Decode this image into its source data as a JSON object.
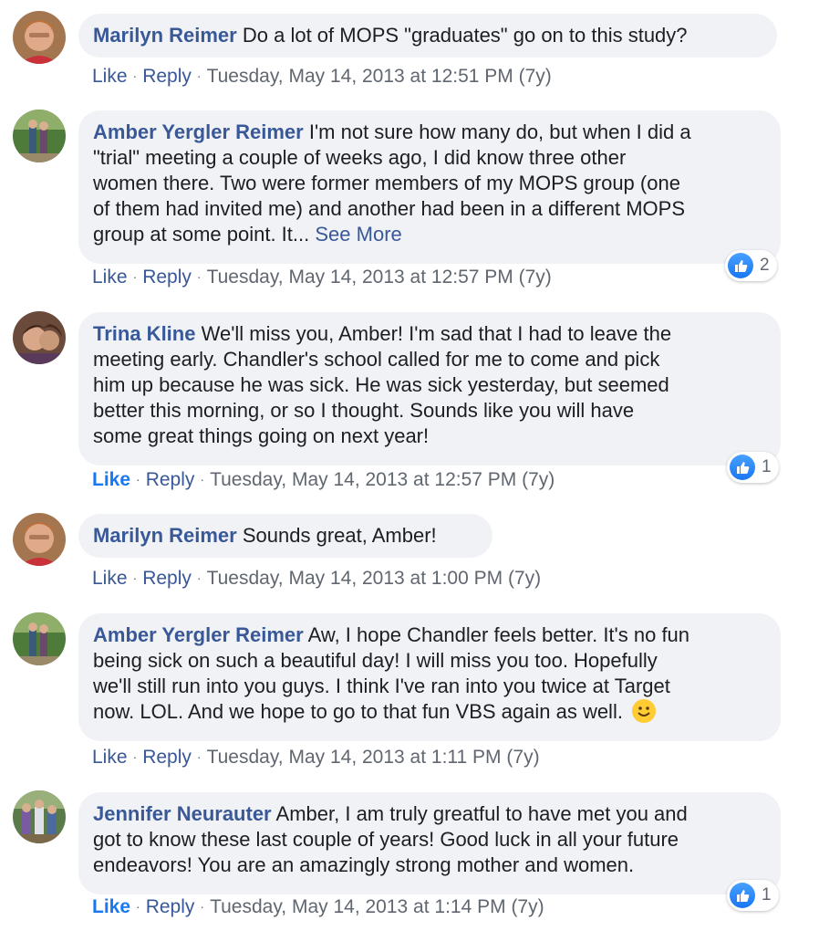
{
  "comments": [
    {
      "author": "Marilyn Reimer",
      "text": "Do a lot of MOPS \"graduates\" go on to this study?",
      "like": "Like",
      "reply": "Reply",
      "timestamp": "Tuesday, May 14, 2013 at 12:51 PM",
      "age": "(7y)",
      "avatar": "avatar-marilyn"
    },
    {
      "author": "Amber Yergler Reimer",
      "text_lines": [
        "I'm not sure how many do, but when I did a",
        "\"trial\" meeting a couple of weeks ago, I did know three other",
        "women there. Two were former members of my MOPS group (one",
        "of them had invited me) and another had been in a different MOPS",
        "group at some point. It..."
      ],
      "see_more": "See More",
      "like": "Like",
      "reply": "Reply",
      "timestamp": "Tuesday, May 14, 2013 at 12:57 PM",
      "age": "(7y)",
      "reaction_count": "2",
      "avatar": "avatar-amber"
    },
    {
      "author": "Trina Kline",
      "text_lines": [
        "We'll miss you, Amber! I'm sad that I had to leave the",
        "meeting early. Chandler's school called for me to come and pick",
        "him up because he was sick. He was sick yesterday, but seemed",
        "better this morning, or so I thought. Sounds like you will have",
        "some great things going on next year!"
      ],
      "like": "Like",
      "reply": "Reply",
      "timestamp": "Tuesday, May 14, 2013 at 12:57 PM",
      "age": "(7y)",
      "reaction_count": "1",
      "liked": true,
      "avatar": "avatar-trina"
    },
    {
      "author": "Marilyn Reimer",
      "text": "Sounds great, Amber!",
      "like": "Like",
      "reply": "Reply",
      "timestamp": "Tuesday, May 14, 2013 at 1:00 PM",
      "age": "(7y)",
      "avatar": "avatar-marilyn"
    },
    {
      "author": "Amber Yergler Reimer",
      "text_lines": [
        "Aw, I hope Chandler feels better. It's no fun",
        "being sick on such a beautiful day! I will miss you too. Hopefully",
        "we'll still run into you guys. I think I've ran into you twice at Target",
        "now. LOL. And we hope to go to that fun VBS again as well."
      ],
      "emoji": "smiley-emoji",
      "like": "Like",
      "reply": "Reply",
      "timestamp": "Tuesday, May 14, 2013 at 1:11 PM",
      "age": "(7y)",
      "avatar": "avatar-amber"
    },
    {
      "author": "Jennifer Neurauter",
      "text_lines": [
        "Amber, I am truly greatful to have met you and",
        "got to know these last couple of years! Good luck in all your future",
        "endeavors! You are an amazingly strong mother and women."
      ],
      "like": "Like",
      "reply": "Reply",
      "timestamp": "Tuesday, May 14, 2013 at 1:14 PM",
      "age": "(7y)",
      "reaction_count": "1",
      "liked": true,
      "avatar": "avatar-jennifer"
    }
  ],
  "colors": {
    "author": "#385898",
    "bubble": "#f0f2f5",
    "meta": "#606770",
    "like_active": "#1877f2"
  }
}
